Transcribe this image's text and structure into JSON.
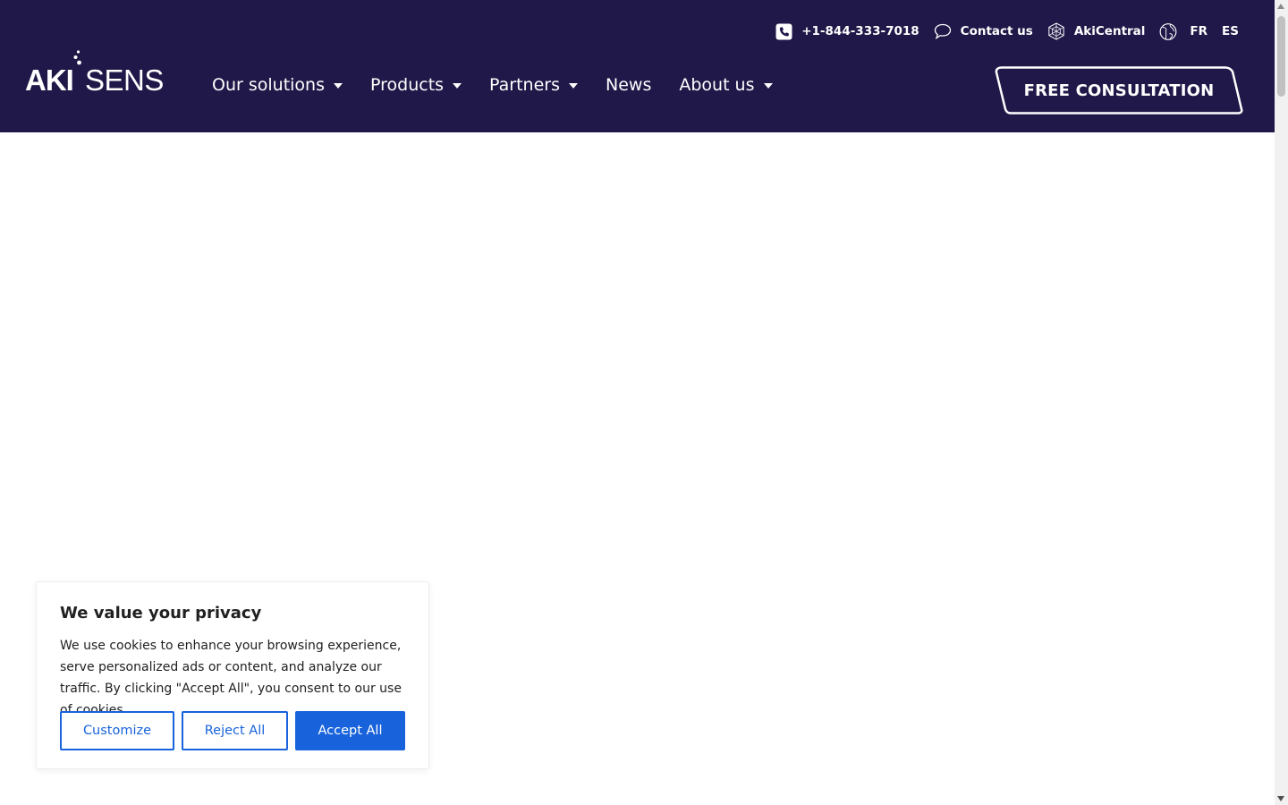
{
  "colors": {
    "header_bg": "#1f1848",
    "cookie_accent": "#1863dc"
  },
  "logo": {
    "text_aki": "AKI",
    "text_sens": "SENS"
  },
  "topbar": {
    "phone": {
      "icon": "phone-icon",
      "label": "+1-844-333-7018"
    },
    "contact": {
      "icon": "chat-bubble-icon",
      "label": "Contact us"
    },
    "akicentral": {
      "icon": "network-icon",
      "label": "AkiCentral"
    },
    "globe_icon": "globe-icon",
    "languages": [
      "FR",
      "ES"
    ]
  },
  "nav": {
    "items": [
      {
        "label": "Our solutions",
        "has_dropdown": true
      },
      {
        "label": "Products",
        "has_dropdown": true
      },
      {
        "label": "Partners",
        "has_dropdown": true
      },
      {
        "label": "News",
        "has_dropdown": false
      },
      {
        "label": "About us",
        "has_dropdown": true
      }
    ]
  },
  "cta": {
    "label": "FREE CONSULTATION"
  },
  "cookie": {
    "title": "We value your privacy",
    "body": "We use cookies to enhance your browsing experience, serve personalized ads or content, and analyze our traffic. By clicking \"Accept All\", you consent to our use of cookies.",
    "customize": "Customize",
    "reject": "Reject All",
    "accept": "Accept All"
  }
}
